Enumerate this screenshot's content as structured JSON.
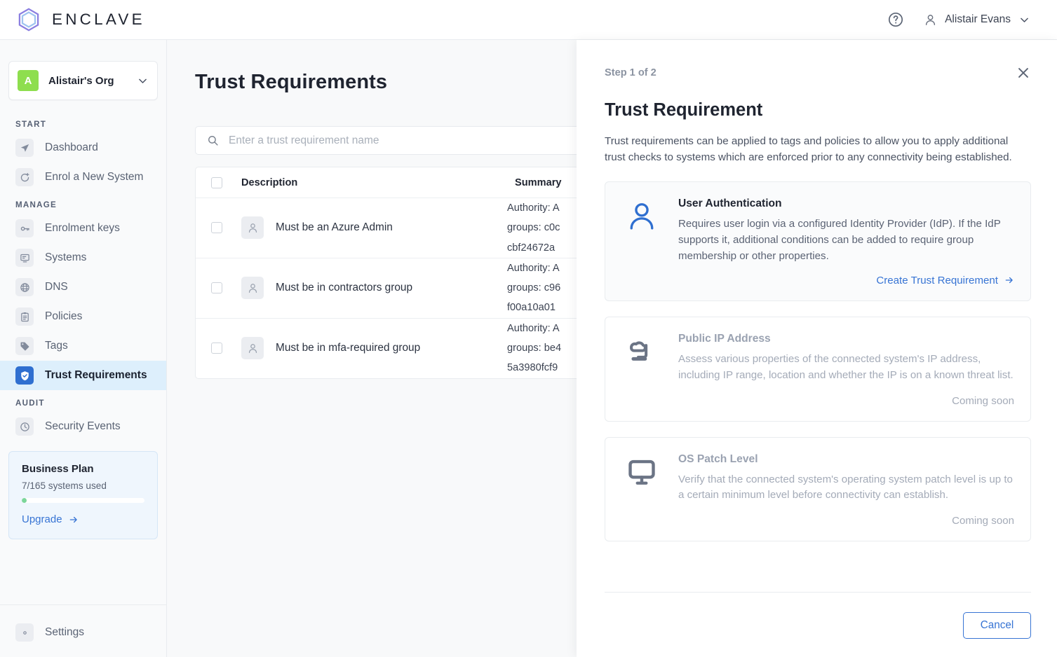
{
  "header": {
    "brand_name": "ENCLAVE",
    "help_icon": "question-circle-icon",
    "user_icon": "user-icon",
    "user_name": "Alistair Evans",
    "chevron_icon": "chevron-down-icon"
  },
  "sidebar": {
    "org": {
      "initial": "A",
      "name": "Alistair's Org",
      "chevron_icon": "chevron-down-icon"
    },
    "sections": [
      {
        "label": "START",
        "items": [
          {
            "label": "Dashboard",
            "icon": "paper-plane-icon",
            "active": false
          },
          {
            "label": "Enrol a New System",
            "icon": "enrol-system-icon",
            "active": false
          }
        ]
      },
      {
        "label": "MANAGE",
        "items": [
          {
            "label": "Enrolment keys",
            "icon": "key-icon",
            "active": false
          },
          {
            "label": "Systems",
            "icon": "systems-icon",
            "active": false
          },
          {
            "label": "DNS",
            "icon": "globe-icon",
            "active": false
          },
          {
            "label": "Policies",
            "icon": "clipboard-icon",
            "active": false
          },
          {
            "label": "Tags",
            "icon": "tag-icon",
            "active": false
          },
          {
            "label": "Trust Requirements",
            "icon": "shield-check-icon",
            "active": true
          }
        ]
      },
      {
        "label": "AUDIT",
        "items": [
          {
            "label": "Security Events",
            "icon": "clock-icon",
            "active": false
          }
        ]
      }
    ],
    "plan": {
      "title": "Business Plan",
      "usage": "7/165 systems used",
      "progress_percent": 4,
      "upgrade_label": "Upgrade",
      "arrow_icon": "arrow-right-icon"
    },
    "settings": {
      "label": "Settings",
      "icon": "gear-icon"
    }
  },
  "main": {
    "page_title": "Trust Requirements",
    "search": {
      "placeholder": "Enter a trust requirement name",
      "value": "",
      "icon": "search-icon"
    },
    "table": {
      "columns": [
        "Description",
        "Summary"
      ],
      "select_all_checkbox": false,
      "rows": [
        {
          "icon": "user-icon",
          "description": "Must be an Azure Admin",
          "summary": "Authority: A\ngroups: c0c\ncbf24672a"
        },
        {
          "icon": "user-icon",
          "description": "Must be in contractors group",
          "summary": "Authority: A\ngroups: c96\nf00a10a01"
        },
        {
          "icon": "user-icon",
          "description": "Must be in mfa-required group",
          "summary": "Authority: A\ngroups: be4\n5a3980fcf9"
        }
      ]
    }
  },
  "drawer": {
    "step": "Step 1 of 2",
    "close_icon": "close-icon",
    "title": "Trust Requirement",
    "description": "Trust requirements can be applied to tags and policies to allow you to apply additional trust checks to systems which are enforced prior to any connectivity being established.",
    "options": [
      {
        "icon": "user-icon",
        "title": "User Authentication",
        "text": "Requires user login via a configured Identity Provider (IdP). If the IdP supports it, additional conditions can be added to require group membership or other properties.",
        "action_label": "Create Trust Requirement",
        "action_icon": "arrow-right-icon",
        "enabled": true
      },
      {
        "icon": "public-ip-icon",
        "title": "Public IP Address",
        "text": "Assess various properties of the connected system's IP address, including IP range, location and whether the IP is on a known threat list.",
        "status_label": "Coming soon",
        "enabled": false
      },
      {
        "icon": "monitor-icon",
        "title": "OS Patch Level",
        "text": "Verify that the connected system's operating system patch level is up to a certain minimum level before connectivity can establish.",
        "status_label": "Coming soon",
        "enabled": false
      }
    ],
    "cancel_label": "Cancel"
  },
  "colors": {
    "accent_blue": "#3774d4",
    "active_nav_bg": "#ddeffc",
    "active_nav_icon": "#2f6fd0",
    "org_badge_green": "#8ede4e",
    "progress_green": "#7cd69a",
    "muted_text": "#a4abb8"
  }
}
